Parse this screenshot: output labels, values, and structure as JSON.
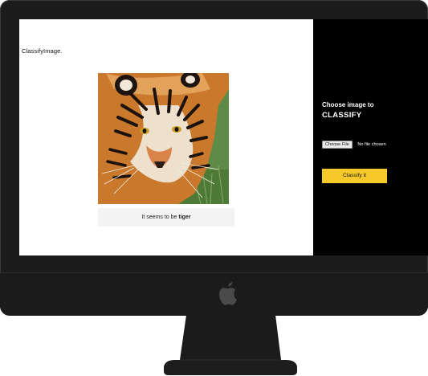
{
  "app": {
    "brand": "ClassifyImage."
  },
  "image": {
    "subject": "tiger",
    "icon": "tiger-photo"
  },
  "result": {
    "prefix": "It seems to be",
    "label": "tiger"
  },
  "sidebar": {
    "prompt_line1": "Choose image to",
    "prompt_line2": "CLASSIFY",
    "file_button": "Choose File",
    "file_status": "No file chosen",
    "classify_button": "Classify it"
  },
  "colors": {
    "accent": "#f7c829",
    "sidebar_bg": "#000000",
    "bezel": "#1c1c1c",
    "result_bg": "#f3f3f3"
  },
  "device": {
    "logo_icon": "apple-logo-icon"
  }
}
